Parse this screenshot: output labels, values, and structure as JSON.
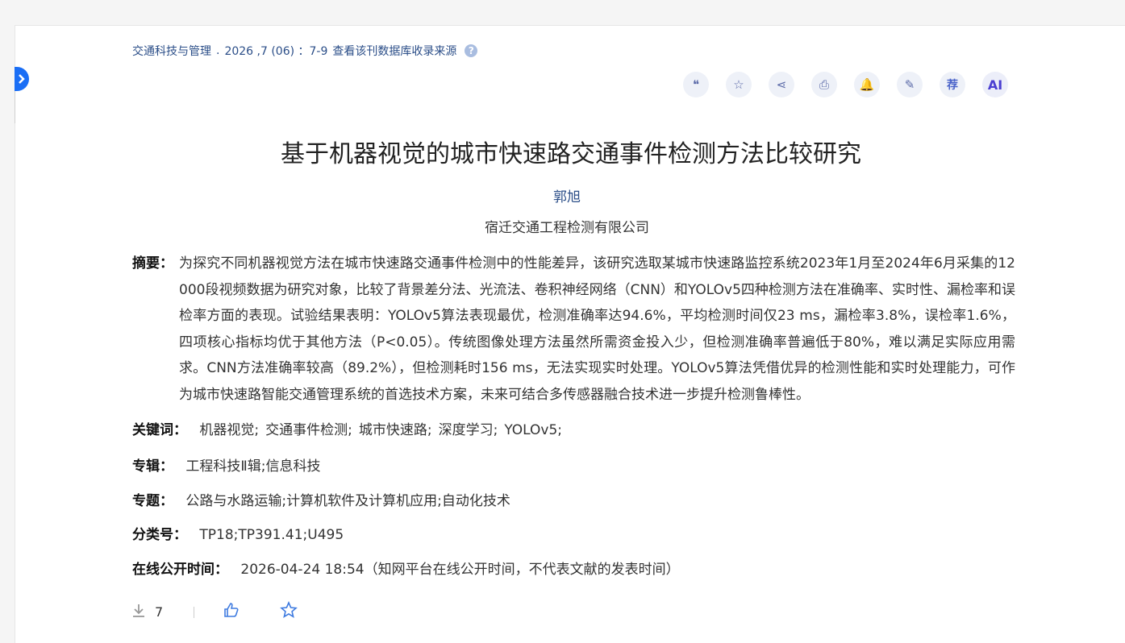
{
  "source": {
    "journal": "交通科技与管理",
    "issue": "2026 ,7 (06) ：7-9",
    "db_link": "查看该刊数据库收录来源",
    "help": "?"
  },
  "toolbar": [
    {
      "name": "cite-button",
      "icon": "quote-icon",
      "glyph": "❝"
    },
    {
      "name": "favorite-button",
      "icon": "star-icon",
      "glyph": "☆"
    },
    {
      "name": "share-button",
      "icon": "share-icon",
      "glyph": "⋖"
    },
    {
      "name": "print-button",
      "icon": "printer-icon",
      "glyph": "⎙"
    },
    {
      "name": "alert-button",
      "icon": "bell-icon",
      "glyph": "🔔"
    },
    {
      "name": "note-button",
      "icon": "pen-icon",
      "glyph": "✎"
    },
    {
      "name": "recommend-button",
      "icon": "recommend-icon",
      "glyph": "荐"
    },
    {
      "name": "ai-button",
      "icon": "ai-icon",
      "glyph": "AI"
    }
  ],
  "article": {
    "title": "基于机器视觉的城市快速路交通事件检测方法比较研究",
    "author": "郭旭",
    "organization": "宿迁交通工程检测有限公司",
    "abstract_label": "摘要：",
    "abstract": "为探究不同机器视觉方法在城市快速路交通事件检测中的性能差异，该研究选取某城市快速路监控系统2023年1月至2024年6月采集的12 000段视频数据为研究对象，比较了背景差分法、光流法、卷积神经网络（CNN）和YOLOv5四种检测方法在准确率、实时性、漏检率和误检率方面的表现。试验结果表明：YOLOv5算法表现最优，检测准确率达94.6%，平均检测时间仅23 ms，漏检率3.8%，误检率1.6%，四项核心指标均优于其他方法（P<0.05）。传统图像处理方法虽然所需资金投入少，但检测准确率普遍低于80%，难以满足实际应用需求。CNN方法准确率较高（89.2%），但检测耗时156 ms，无法实现实时处理。YOLOv5算法凭借优异的检测性能和实时处理能力，可作为城市快速路智能交通管理系统的首选技术方案，未来可结合多传感器融合技术进一步提升检测鲁棒性。",
    "keywords_label": "关键词：",
    "keywords": [
      "机器视觉;",
      "交通事件检测;",
      "城市快速路;",
      "深度学习;",
      "YOLOv5;"
    ],
    "series_label": "专辑：",
    "series": "工程科技Ⅱ辑;信息科技",
    "topic_label": "专题：",
    "topic": "公路与水路运输;计算机软件及计算机应用;自动化技术",
    "class_label": "分类号：",
    "class_no": "TP18;TP391.41;U495",
    "online_label": "在线公开时间：",
    "online_time": "2026-04-24 18:54（知网平台在线公开时间，不代表文献的发表时间）"
  },
  "stats": {
    "downloads": "7"
  }
}
